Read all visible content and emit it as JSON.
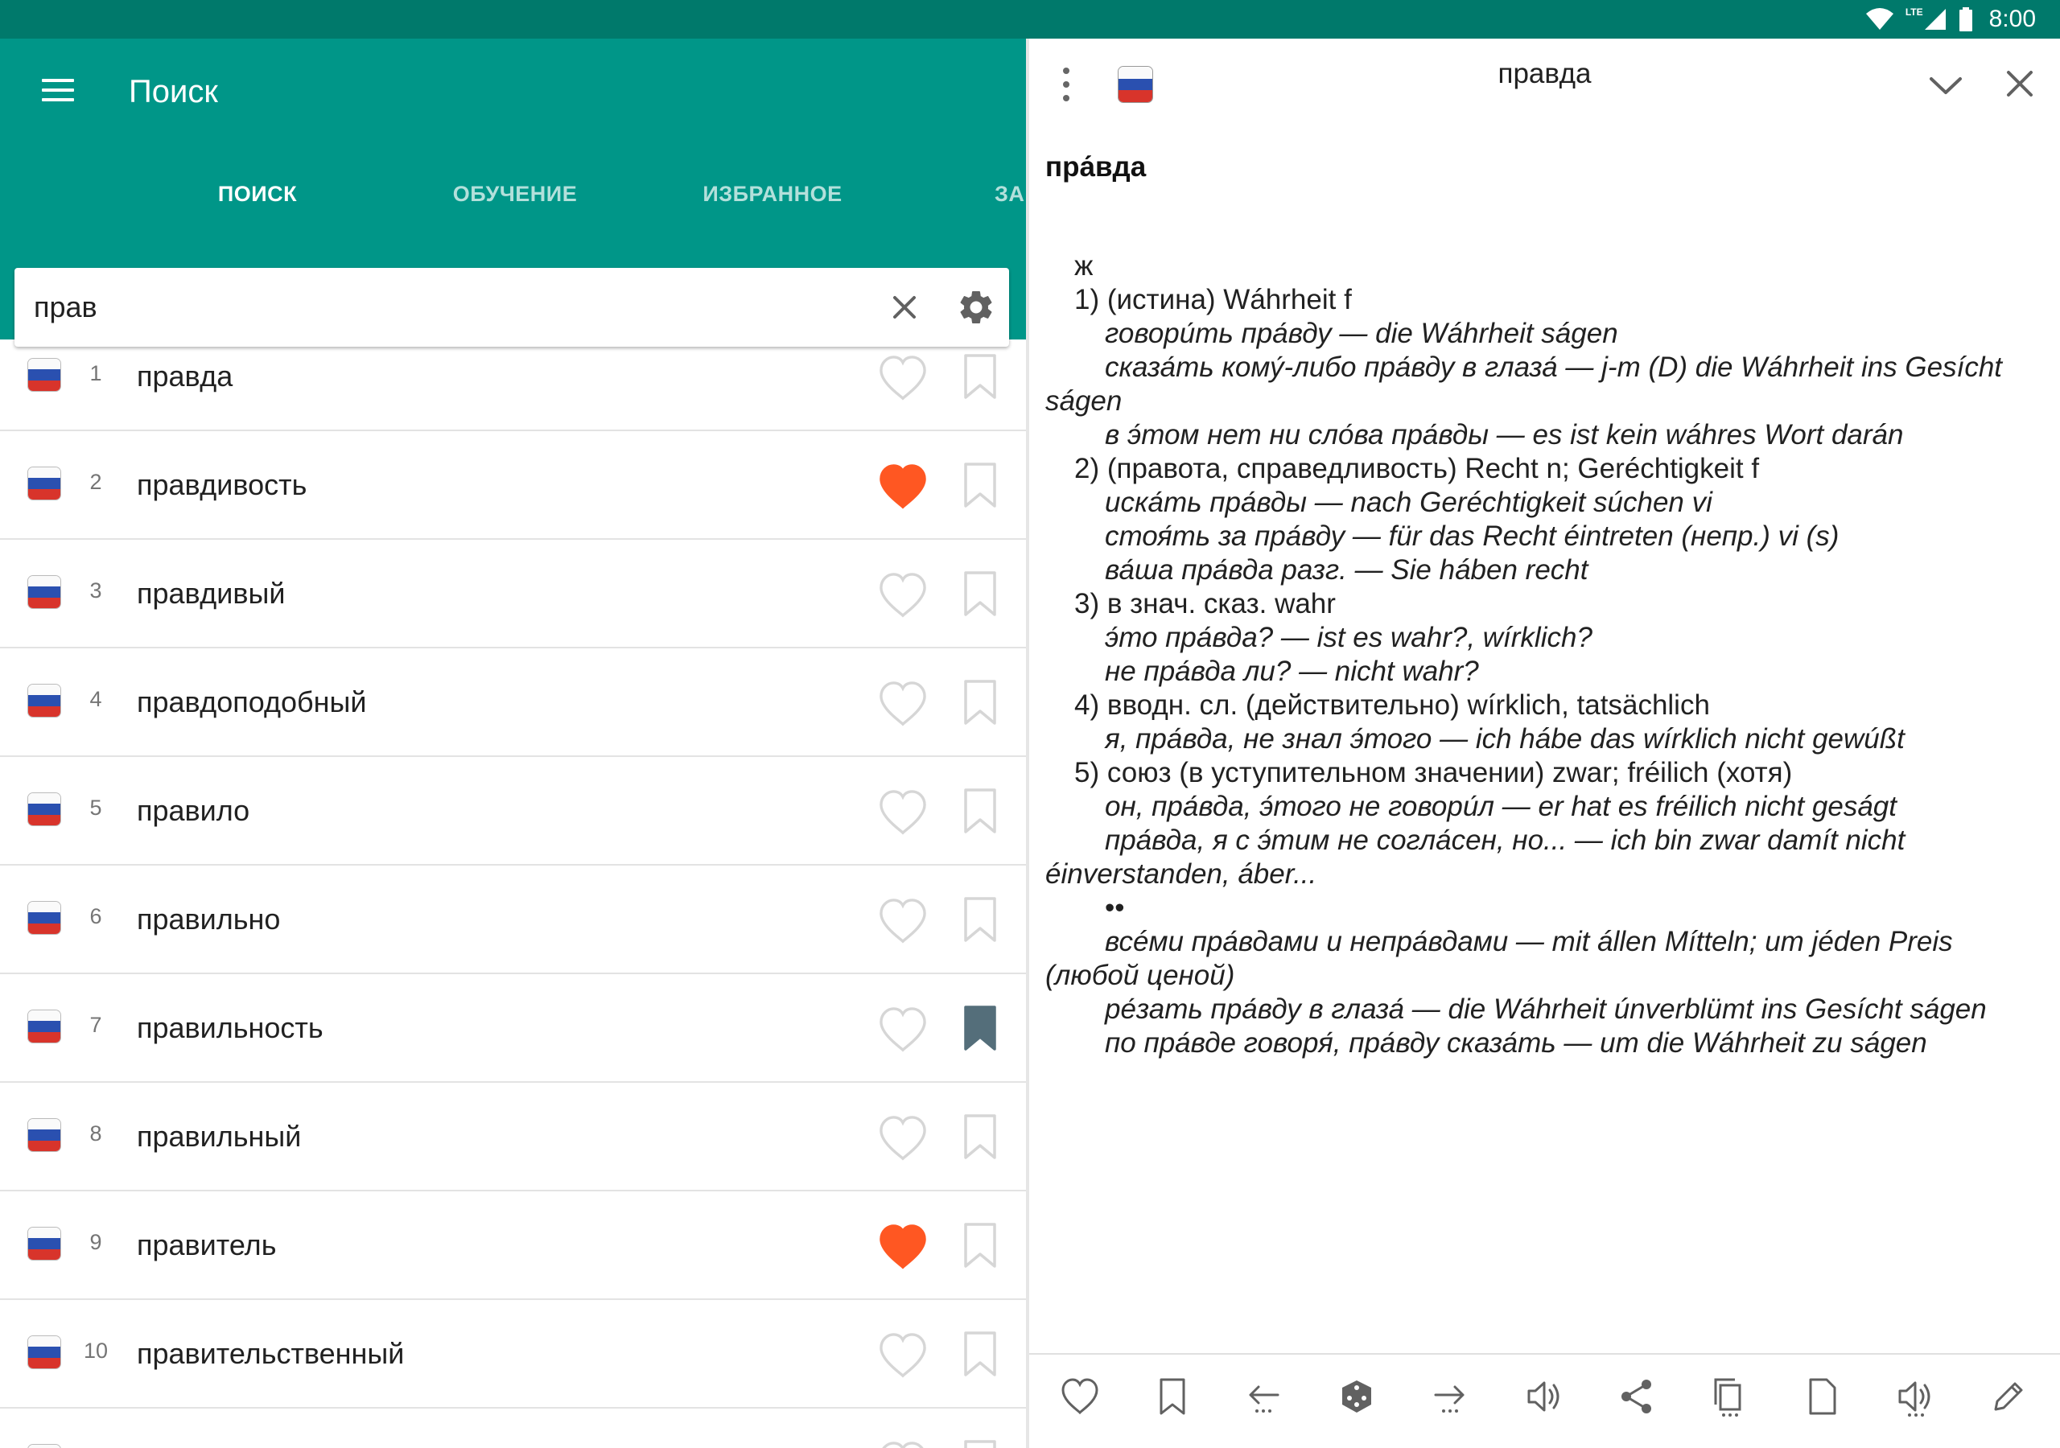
{
  "status_bar": {
    "time": "8:00",
    "network": "LTE"
  },
  "app_bar": {
    "title": "Поиск",
    "tabs": [
      {
        "label": "ПОИСК",
        "active": true
      },
      {
        "label": "ОБУЧЕНИЕ",
        "active": false
      },
      {
        "label": "ИЗБРАННОЕ",
        "active": false
      },
      {
        "label": "ЗАКЛ",
        "active": false
      }
    ]
  },
  "search": {
    "value": "прав",
    "placeholder": ""
  },
  "results": [
    {
      "num": "1",
      "word": "правда",
      "favorite": false,
      "bookmarked": false
    },
    {
      "num": "2",
      "word": "правдивость",
      "favorite": true,
      "bookmarked": false
    },
    {
      "num": "3",
      "word": "правдивый",
      "favorite": false,
      "bookmarked": false
    },
    {
      "num": "4",
      "word": "правдоподобный",
      "favorite": false,
      "bookmarked": false
    },
    {
      "num": "5",
      "word": "правило",
      "favorite": false,
      "bookmarked": false
    },
    {
      "num": "6",
      "word": "правильно",
      "favorite": false,
      "bookmarked": false
    },
    {
      "num": "7",
      "word": "правильность",
      "favorite": false,
      "bookmarked": true
    },
    {
      "num": "8",
      "word": "правильный",
      "favorite": false,
      "bookmarked": false
    },
    {
      "num": "9",
      "word": "правитель",
      "favorite": true,
      "bookmarked": false
    },
    {
      "num": "10",
      "word": "правительственный",
      "favorite": false,
      "bookmarked": false
    },
    {
      "num": "",
      "word": "",
      "favorite": false,
      "bookmarked": false
    }
  ],
  "colors": {
    "status_bar": "#00796b",
    "app_bar": "#009688",
    "favorite_active": "#ff5722",
    "icon_inactive": "#d6d6d6",
    "bookmark_active": "#546e7a",
    "flag_white": "#fafafa",
    "flag_blue": "#2a50b0",
    "flag_red": "#d8342b"
  },
  "detail": {
    "title": "правда",
    "headword": "пра́вда",
    "lines": [
      {
        "indent": 1,
        "italic": false,
        "text": "ж"
      },
      {
        "indent": 1,
        "italic": false,
        "text": "1) (истина) Wáhrheit f"
      },
      {
        "indent": 2,
        "italic": true,
        "text": "говори́ть пра́вду — die Wáhrheit ságen"
      },
      {
        "indent": 2,
        "italic": true,
        "text": "сказа́ть кому́-либо пра́вду в глаза́ — j-m (D) die Wáhrheit ins Gesícht"
      },
      {
        "indent": 0,
        "italic": true,
        "text": "ságen"
      },
      {
        "indent": 2,
        "italic": true,
        "text": "в э́том нет ни сло́ва пра́вды — es ist kein wáhres Wort darán"
      },
      {
        "indent": 1,
        "italic": false,
        "text": "2) (правота, справедливость) Recht n; Geréchtigkeit f"
      },
      {
        "indent": 2,
        "italic": true,
        "text": "иска́ть пра́вды — nach Geréchtigkeit súchen vi"
      },
      {
        "indent": 2,
        "italic": true,
        "text": "стоя́ть за пра́вду — für das Recht éintreten (непр.) vi (s)"
      },
      {
        "indent": 2,
        "italic": true,
        "text": "ва́ша пра́вда разг. — Sie háben recht"
      },
      {
        "indent": 1,
        "italic": false,
        "text": "3) в знач. сказ. wahr"
      },
      {
        "indent": 2,
        "italic": true,
        "text": "э́то пра́вда? — ist es wahr?, wírklich?"
      },
      {
        "indent": 2,
        "italic": true,
        "text": "не пра́вда ли? — nicht wahr?"
      },
      {
        "indent": 1,
        "italic": false,
        "text": "4) вводн. сл. (действительно) wírklich, tatsächlich"
      },
      {
        "indent": 2,
        "italic": true,
        "text": "я, пра́вда, не знал э́того — ich hábe das wírklich nicht gewúßt"
      },
      {
        "indent": 1,
        "italic": false,
        "text": "5) союз (в уступительном значении) zwar; fréilich (хотя)"
      },
      {
        "indent": 2,
        "italic": true,
        "text": "он, пра́вда, э́того не говори́л — er hat es fréilich nicht geságt"
      },
      {
        "indent": 2,
        "italic": true,
        "text": "пра́вда, я с э́тим не согла́сен, но... — ich bin zwar damít nicht"
      },
      {
        "indent": 0,
        "italic": true,
        "text": "éinverstanden, áber..."
      },
      {
        "indent": 2,
        "italic": false,
        "text": "••"
      },
      {
        "indent": 2,
        "italic": true,
        "text": "всéми пра́вдами и непра́вдами — mit állen Míttеln; um jéden Preis"
      },
      {
        "indent": 0,
        "italic": true,
        "text": "(любой ценой)"
      },
      {
        "indent": 2,
        "italic": true,
        "text": "ре́зать пра́вду в глаза́ — die Wáhrheit únverblümt ins Gesícht ságen"
      },
      {
        "indent": 2,
        "italic": true,
        "text": "по пра́вде говоря́, пра́вду сказа́ть — um die Wáhrheit zu ságen"
      }
    ],
    "bottom_actions": [
      "heart-icon",
      "bookmark-icon",
      "back-arrow-icon",
      "dice-icon",
      "forward-arrow-icon",
      "speaker-icon",
      "share-icon",
      "copy-icon",
      "page-icon",
      "speaker-alt-icon",
      "edit-icon"
    ]
  }
}
